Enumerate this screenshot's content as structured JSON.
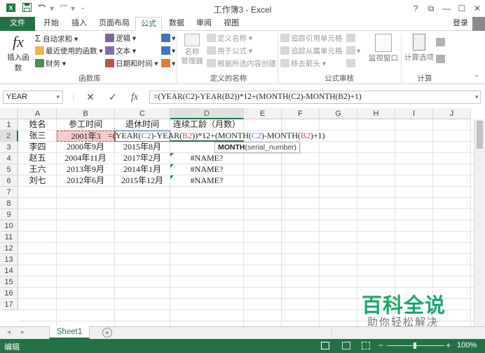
{
  "window": {
    "title": "工作簿3 - Excel",
    "help_label": "?",
    "restore_ribbon_glyph": "⧉",
    "minimize_glyph": "—",
    "maximize_glyph": "☐",
    "close_glyph": "✕"
  },
  "quick_access": {
    "save_icon": "save-icon",
    "undo_icon": "undo-icon",
    "redo_icon": "redo-icon"
  },
  "ribbon_tabs": {
    "file": "文件",
    "home": "开始",
    "insert": "插入",
    "page_layout": "页面布局",
    "formulas": "公式",
    "data": "数据",
    "review": "审阅",
    "view": "视图",
    "login": "登录"
  },
  "ribbon": {
    "insert_function": "插入函数",
    "fx_glyph": "fx",
    "autosum": "自动求和",
    "recent": "最近使用的函数",
    "financial": "财务",
    "logical": "逻辑",
    "text": "文本",
    "datetime": "日期和时间",
    "function_library": "函数库",
    "name_manager_line1": "名称",
    "name_manager_line2": "管理器",
    "define_name": "定义名称",
    "use_in_formula": "用于公式",
    "create_from_selection": "根据所选内容创建",
    "defined_names": "定义的名称",
    "trace_precedents": "追踪引用单元格",
    "trace_dependents": "追踪从属单元格",
    "remove_arrows": "移去箭头",
    "formula_auditing": "公式审核",
    "watch_window": "监视窗口",
    "calc_options": "计算选项",
    "calculation": "计算"
  },
  "formula_bar": {
    "name_box": "YEAR",
    "cancel_glyph": "✕",
    "enter_glyph": "✓",
    "fx_glyph": "fx",
    "formula": "=(YEAR(C2)-YEAR(B2))*12+(MONTH(C2)-MONTH(B2)+1)"
  },
  "grid": {
    "columns": [
      "A",
      "B",
      "C",
      "D",
      "E",
      "F",
      "G",
      "H",
      "I",
      "J"
    ],
    "rows": [
      "1",
      "2",
      "3",
      "4",
      "5",
      "6",
      "7",
      "8",
      "9",
      "10",
      "11",
      "12",
      "13",
      "14",
      "15",
      "16",
      "17"
    ],
    "header_row": [
      "姓名",
      "参工时间",
      "退休时间",
      "连续工龄（月数）"
    ],
    "data_rows": [
      [
        "张三",
        "2001年3",
        "",
        ""
      ],
      [
        "李四",
        "2000年9月",
        "2015年8月",
        ""
      ],
      [
        "赵五",
        "2004年11月",
        "2017年2月",
        "#NAME?"
      ],
      [
        "王六",
        "2013年9月",
        "2014年1月",
        "#NAME?"
      ],
      [
        "刘七",
        "2012年6月",
        "2015年12月",
        "#NAME?"
      ]
    ],
    "editing_formula": {
      "p1": "=(YEAR(",
      "r1": "C2",
      "p2": ")-YEAR(",
      "r2": "B2",
      "p3": "))*12+(MONTH(",
      "r3": "C2",
      "p4": ")-MONTH(",
      "r4": "B2",
      "p5": ")+1)"
    },
    "tooltip_fn": "MONTH",
    "tooltip_args": "(serial_number)"
  },
  "sheet": {
    "tab": "Sheet1",
    "add_glyph": "+",
    "scroll_left": "◂",
    "scroll_right": "▸"
  },
  "status": {
    "mode": "编辑",
    "zoom": "100%",
    "zoom_minus": "−",
    "zoom_plus": "+"
  },
  "watermark": {
    "line1": "百科全说",
    "line2": "助你轻松解决"
  },
  "colors": {
    "excel_green": "#217346",
    "ref_blue": "#4472c4",
    "ref_red": "#c0504d",
    "b2_fill": "#f4cccc"
  }
}
